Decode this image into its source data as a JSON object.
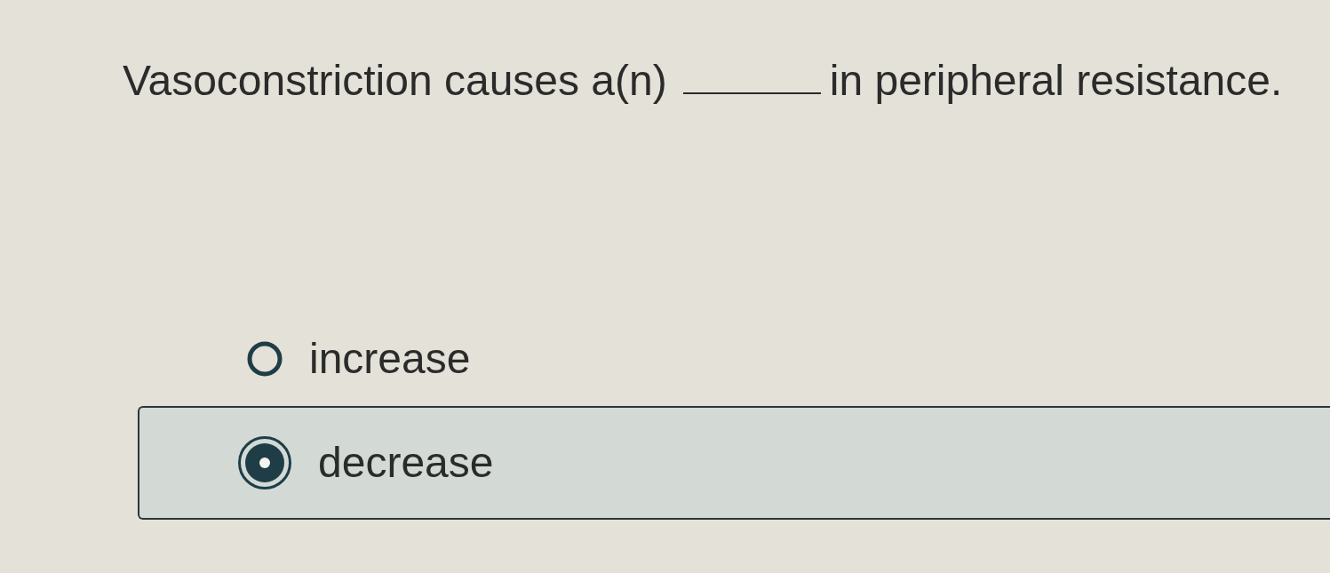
{
  "question": {
    "parts": [
      {
        "kind": "text",
        "text": "Vasoconstriction causes a(n)"
      },
      {
        "kind": "blank"
      },
      {
        "kind": "text",
        "text": "in peripheral resistance."
      }
    ]
  },
  "options": [
    {
      "label": "increase",
      "selected": false
    },
    {
      "label": "decrease",
      "selected": true
    }
  ]
}
